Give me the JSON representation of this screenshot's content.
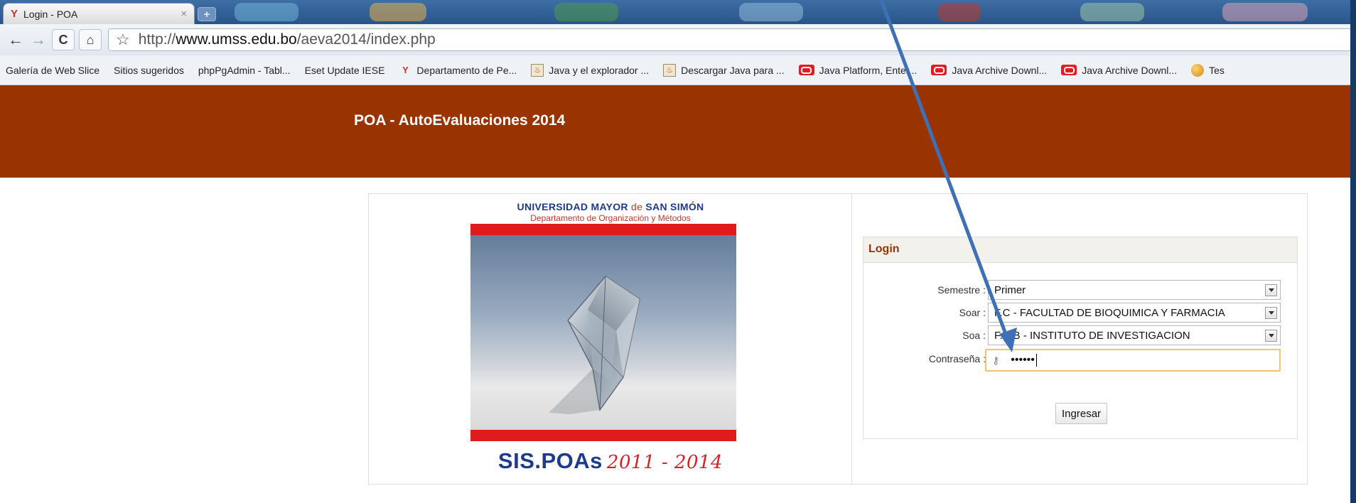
{
  "browser": {
    "tab_title": "Login - POA",
    "tab_close": "×",
    "new_tab": "+",
    "nav": {
      "back": "←",
      "forward": "→",
      "reload": "C",
      "home": "⌂",
      "star": "☆"
    },
    "url_prefix": "http://",
    "url_domain": "www.umss.edu.bo",
    "url_path": "/aeva2014/index.php",
    "bookmarks": [
      {
        "label": "Galería de Web Slice",
        "icon": "page-icon"
      },
      {
        "label": "Sitios sugeridos",
        "icon": "page-icon"
      },
      {
        "label": "phpPgAdmin - Tabl...",
        "icon": "page-icon"
      },
      {
        "label": "Eset Update IESE",
        "icon": "page-icon"
      },
      {
        "label": "Departamento de Pe...",
        "icon": "umss-icon"
      },
      {
        "label": "Java y el explorador ...",
        "icon": "java-icon"
      },
      {
        "label": "Descargar Java para ...",
        "icon": "java-icon"
      },
      {
        "label": "Java Platform, Enter...",
        "icon": "oracle-icon"
      },
      {
        "label": "Java Archive Downl...",
        "icon": "oracle-icon"
      },
      {
        "label": "Java Archive Downl...",
        "icon": "oracle-icon"
      },
      {
        "label": "Tes",
        "icon": "globe-icon"
      }
    ]
  },
  "site": {
    "title": "POA - AutoEvaluaciones 2014"
  },
  "logo": {
    "university_a": "UNIVERSIDAD MAYOR",
    "university_de": "de",
    "university_b": "SAN SIMÓN",
    "department": "Departamento de Organización y Métodos",
    "product": "SIS.POAs",
    "years": "2011 - 2014"
  },
  "login": {
    "heading": "Login",
    "semestre_label": "Semestre :",
    "semestre_value": "Primer",
    "soar_label": "Soar :",
    "soar_value": "F.C - FACULTAD DE BIOQUIMICA Y FARMACIA",
    "soa_label": "Soa :",
    "soa_value": "F.C.B - INSTITUTO DE INVESTIGACION",
    "password_label": "Contraseña :",
    "password_mask": "••••••",
    "submit": "Ingresar"
  },
  "colors": {
    "header_bg": "#993300",
    "panel_title": "#993300",
    "poster_red": "#e01b1b",
    "logo_blue": "#1f3a8a",
    "annotation_arrow": "#3f6fb5"
  }
}
